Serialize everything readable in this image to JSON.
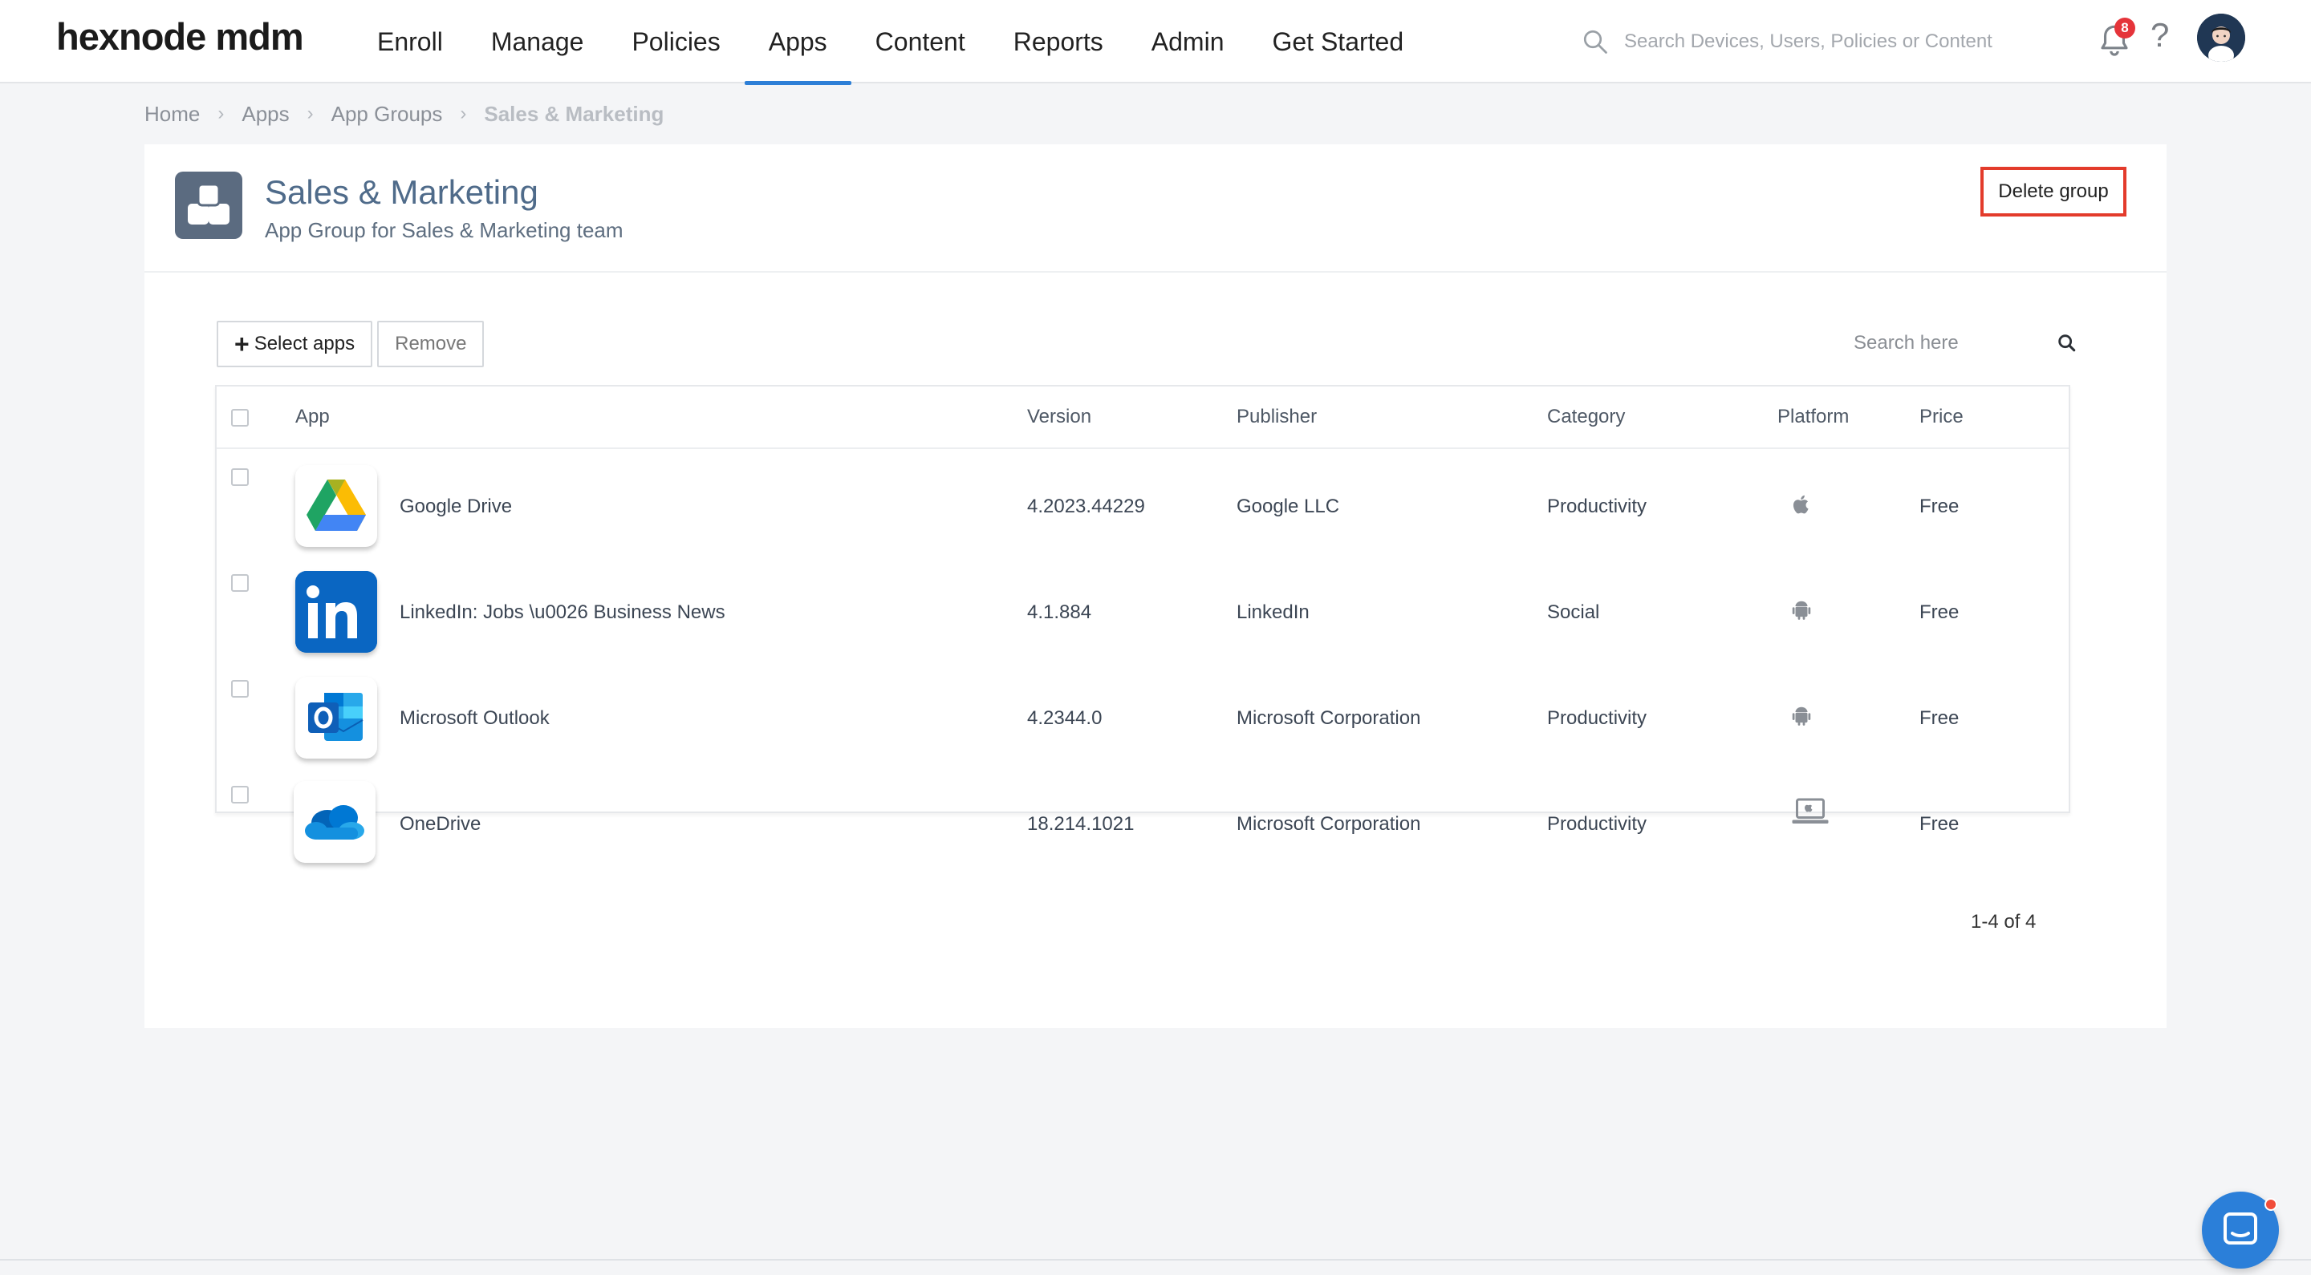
{
  "brand": {
    "logo": "hexnode mdm",
    "accent": "#2d7fd7"
  },
  "nav": [
    {
      "label": "Enroll",
      "active": false
    },
    {
      "label": "Manage",
      "active": false
    },
    {
      "label": "Policies",
      "active": false
    },
    {
      "label": "Apps",
      "active": true
    },
    {
      "label": "Content",
      "active": false
    },
    {
      "label": "Reports",
      "active": false
    },
    {
      "label": "Admin",
      "active": false
    },
    {
      "label": "Get Started",
      "active": false
    }
  ],
  "global_search": {
    "placeholder": "Search Devices, Users, Policies or Content",
    "icon": "search-icon"
  },
  "notifications": {
    "count": "8",
    "icon": "bell-icon",
    "badge_color": "#e5343a"
  },
  "help": {
    "label": "?"
  },
  "breadcrumb": [
    {
      "label": "Home"
    },
    {
      "label": "Apps"
    },
    {
      "label": "App Groups"
    },
    {
      "label": "Sales & Marketing",
      "current": true
    }
  ],
  "group": {
    "title": "Sales & Marketing",
    "description": "App Group for Sales & Marketing team",
    "icon": "app-group-icon",
    "delete_label": "Delete group",
    "delete_highlight_color": "#e33b2b"
  },
  "toolbar": {
    "select_apps_label": "Select apps",
    "remove_label": "Remove"
  },
  "table_search": {
    "placeholder": "Search here"
  },
  "table": {
    "columns": {
      "app": "App",
      "version": "Version",
      "publisher": "Publisher",
      "category": "Category",
      "platform": "Platform",
      "price": "Price"
    },
    "rows": [
      {
        "name": "Google Drive",
        "icon": "google-drive-icon",
        "version": "4.2023.44229",
        "publisher": "Google LLC",
        "category": "Productivity",
        "platform": "apple-icon",
        "price": "Free"
      },
      {
        "name": "LinkedIn: Jobs \\u0026 Business News",
        "icon": "linkedin-icon",
        "version": "4.1.884",
        "publisher": "LinkedIn",
        "category": "Social",
        "platform": "android-icon",
        "price": "Free"
      },
      {
        "name": "Microsoft Outlook",
        "icon": "outlook-icon",
        "version": "4.2344.0",
        "publisher": "Microsoft Corporation",
        "category": "Productivity",
        "platform": "android-icon",
        "price": "Free"
      },
      {
        "name": "OneDrive",
        "icon": "onedrive-icon",
        "version": "18.214.1021",
        "publisher": "Microsoft Corporation",
        "category": "Productivity",
        "platform": "mac-laptop-icon",
        "price": "Free"
      }
    ]
  },
  "pagination": {
    "label": "1-4 of 4"
  },
  "chat": {
    "icon": "chat-icon",
    "color": "#2b7fd9"
  }
}
